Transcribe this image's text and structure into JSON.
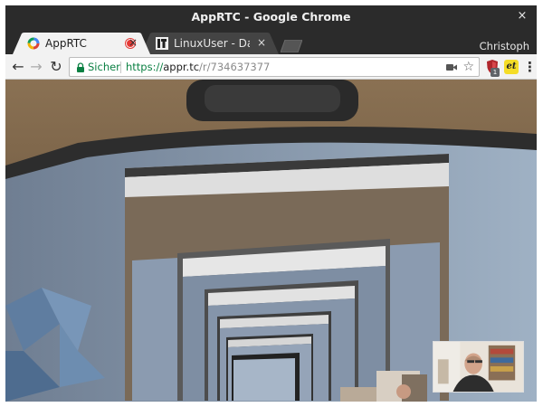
{
  "window": {
    "title": "AppRTC - Google Chrome",
    "close_glyph": "×"
  },
  "tabs": [
    {
      "label": "AppRTC",
      "icon": "apprtc-favicon",
      "recording": true,
      "active": true,
      "close_glyph": "×"
    },
    {
      "label": "LinuxUser - Das Magazin",
      "icon": "linuxuser-favicon",
      "active": false,
      "close_glyph": "×"
    }
  ],
  "profile": {
    "name": "Christoph"
  },
  "toolbar": {
    "back_glyph": "←",
    "forward_glyph": "→",
    "reload_glyph": "↻",
    "security_label": "Sicher",
    "url_scheme": "https://",
    "url_host": "appr.tc",
    "url_path": "/r/734637377",
    "star_glyph": "☆",
    "menu_glyph": "⋮",
    "extensions": [
      {
        "name": "ublock-shield-icon",
        "badge": "1"
      },
      {
        "name": "et-extension-icon",
        "label": "et"
      }
    ]
  },
  "colors": {
    "titlebar": "#2b2b2b",
    "toolbar": "#f2f2f2",
    "secure_green": "#0b8043",
    "recording_red": "#e53935"
  }
}
